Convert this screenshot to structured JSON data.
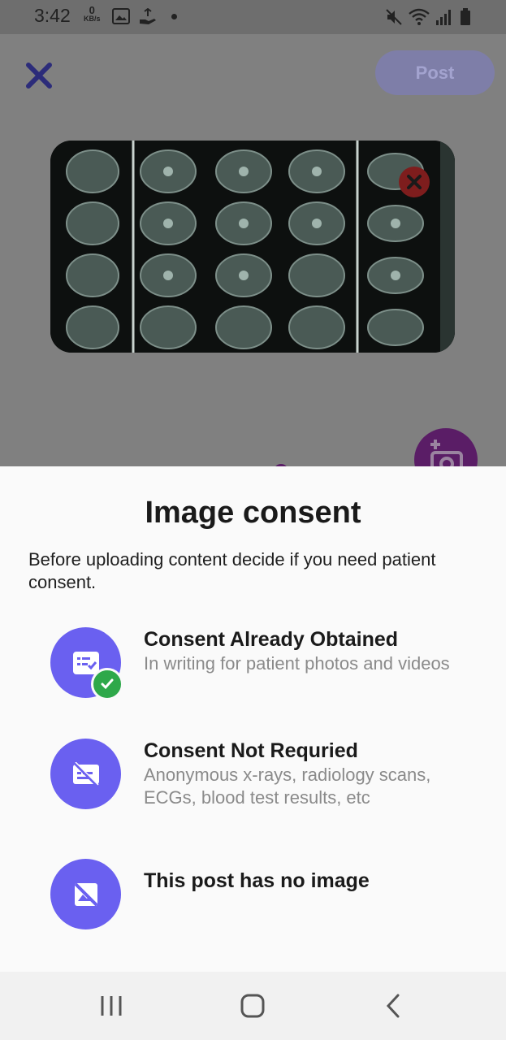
{
  "status_bar": {
    "time": "3:42",
    "speed_value": "0",
    "speed_unit": "KB/s",
    "icons": [
      "gallery-icon",
      "hand-icon",
      "notification-dot",
      "mute-icon",
      "wifi-icon",
      "signal-icon",
      "battery-icon"
    ]
  },
  "header": {
    "close_icon": "close-icon",
    "post_label": "Post"
  },
  "preview": {
    "remove_icon": "remove-image-icon",
    "camera_icon": "add-photo-icon"
  },
  "sheet": {
    "title": "Image consent",
    "description": "Before uploading content decide if you need patient consent.",
    "options": [
      {
        "title": "Consent Already Obtained",
        "subtitle": "In writing for patient photos and videos",
        "icon": "consent-document-icon",
        "selected": true
      },
      {
        "title": "Consent Not Requried",
        "subtitle": "Anonymous x-rays, radiology scans, ECGs, blood test results, etc",
        "icon": "no-consent-card-icon",
        "selected": false
      },
      {
        "title": "This post has no image",
        "subtitle": "",
        "icon": "no-image-icon",
        "selected": false
      }
    ]
  },
  "colors": {
    "accent": "#6a60f0",
    "check": "#2ea84a",
    "post_disabled": "#7e7ea8"
  },
  "nav_bar": {
    "icons": [
      "recent-apps-icon",
      "home-icon",
      "back-icon"
    ]
  }
}
